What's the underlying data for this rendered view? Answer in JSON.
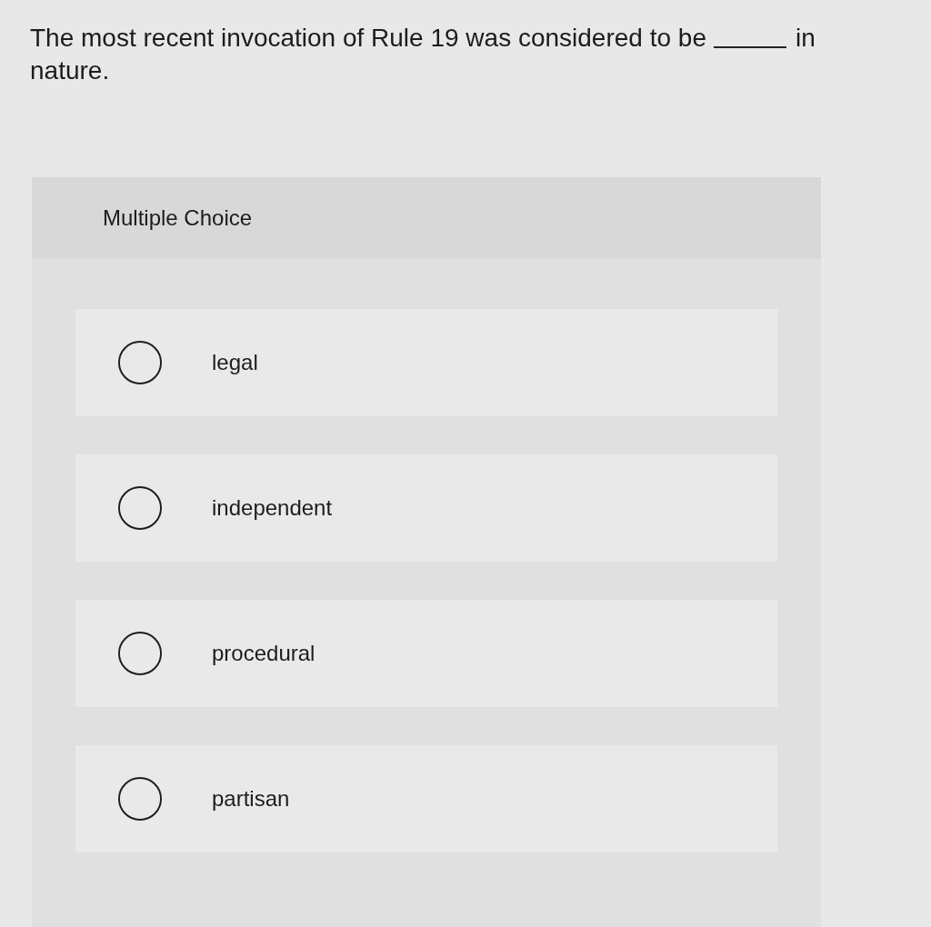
{
  "question": {
    "lines": [
      [
        {
          "kind": "text",
          "text": "The most recent invocation of Rule 19 was considered to be"
        },
        {
          "kind": "blank"
        },
        {
          "kind": "text",
          "text": "in"
        }
      ],
      [
        {
          "kind": "text",
          "text": "nature."
        }
      ]
    ]
  },
  "card": {
    "header": "Multiple Choice",
    "options": [
      {
        "label": "legal",
        "selected": false
      },
      {
        "label": "independent",
        "selected": false
      },
      {
        "label": "procedural",
        "selected": false
      },
      {
        "label": "partisan",
        "selected": false
      }
    ]
  }
}
